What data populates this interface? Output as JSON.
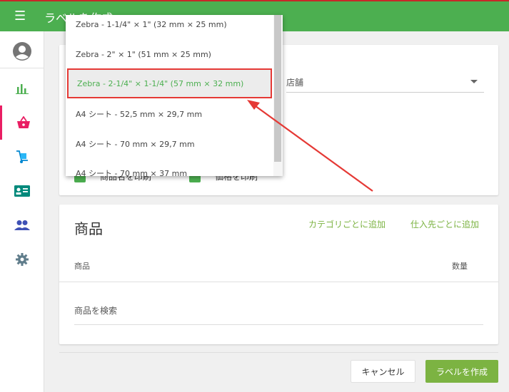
{
  "header": {
    "title": "ラベルを作成",
    "menu_icon": "hamburger-menu-icon"
  },
  "sidebar": {
    "items": [
      {
        "icon": "user-avatar-icon"
      },
      {
        "icon": "bar-chart-icon"
      },
      {
        "icon": "shopping-basket-icon",
        "active": true
      },
      {
        "icon": "hand-truck-icon"
      },
      {
        "icon": "id-card-icon"
      },
      {
        "icon": "people-icon"
      },
      {
        "icon": "gear-icon"
      }
    ]
  },
  "settings_card": {
    "store_label": "店舗",
    "checkbox_1_label": "商品名を印刷",
    "checkbox_2_label": "価格を印刷"
  },
  "dropdown": {
    "options": [
      "Zebra - 1-1/4\" × 1\" (32 mm × 25 mm)",
      "Zebra - 2\" × 1\" (51 mm × 25 mm)",
      "Zebra - 2-1/4\" × 1-1/4\" (57 mm × 32 mm)",
      "A4 シート - 52,5 mm × 29,7 mm",
      "A4 シート - 70 mm × 29,7 mm",
      "A4 シート - 70 mm × 37 mm"
    ],
    "selected_index": 2
  },
  "products_card": {
    "title": "商品",
    "add_by_category": "カテゴリごとに追加",
    "add_by_supplier": "仕入先ごとに追加",
    "col_product": "商品",
    "col_quantity": "数量",
    "search_placeholder": "商品を検索"
  },
  "footer": {
    "cancel_label": "キャンセル",
    "create_label": "ラベルを作成"
  },
  "colors": {
    "brand_green": "#4caf50",
    "accent_pink": "#e91e63",
    "highlight_red": "#e53935",
    "button_green": "#7cb342"
  }
}
